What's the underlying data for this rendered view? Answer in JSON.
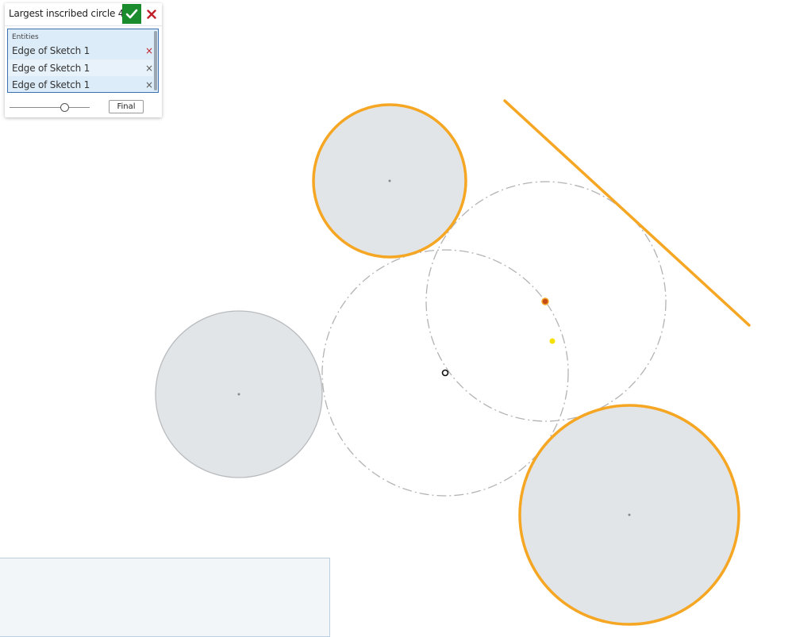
{
  "dialog": {
    "title": "Largest inscribed circle 4",
    "confirm_icon": "checkmark-icon",
    "cancel_icon": "close-icon",
    "entities_label": "Entities",
    "entities": [
      {
        "label": "Edge of Sketch 1"
      },
      {
        "label": "Edge of Sketch 1"
      },
      {
        "label": "Edge of Sketch 1"
      }
    ],
    "remove_glyph": "×",
    "slider_value": 0.69,
    "final_label": "Final"
  },
  "colors": {
    "selection_orange": "#f5a623",
    "circle_fill": "#e2e5e8",
    "circle_edge": "#b9bcbf",
    "construction_line": "#b3b3b3",
    "confirm_green": "#1a8c2e",
    "cancel_red": "#c0202a",
    "preview_point": "#f5e100"
  }
}
